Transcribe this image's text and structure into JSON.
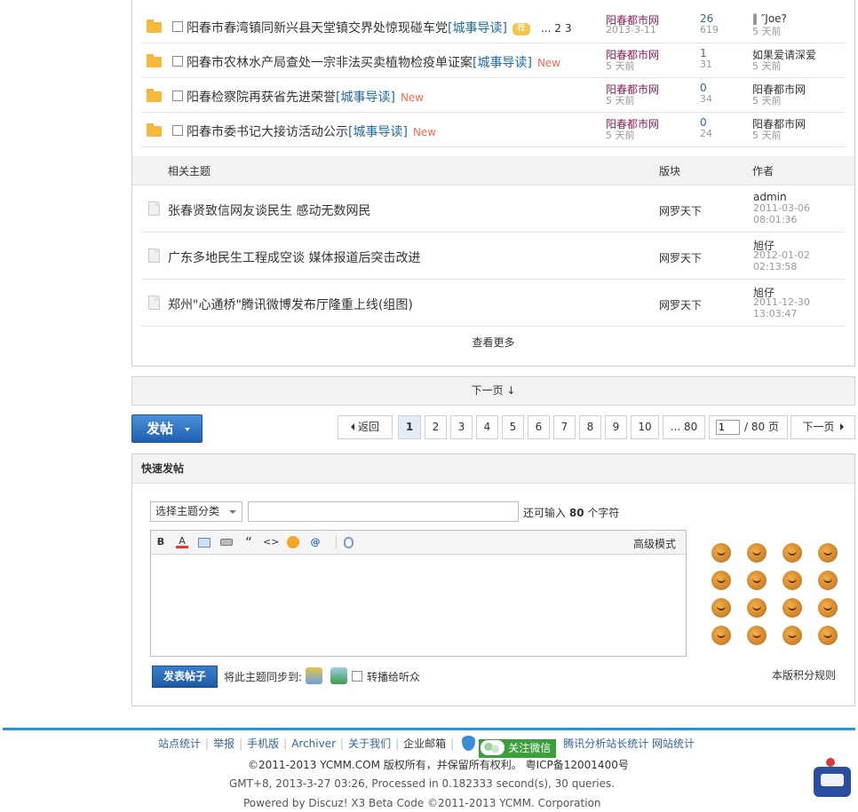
{
  "threads": [
    {
      "title": "阳春市春湾镇同新兴县天堂镇交界处惊现碰车党",
      "type": "[城事导读]",
      "badge": "荐",
      "pages": [
        "...",
        "2",
        "3"
      ],
      "new": "",
      "author": "阳春都市网",
      "date": "2013-3-11",
      "replies": "26",
      "views": "619",
      "lastpost": "‖ ″Joe?",
      "lastdate": "5 天前"
    },
    {
      "title": "阳春市农林水产局查处一宗非法买卖植物检疫单证案",
      "type": "[城事导读]",
      "badge": "",
      "pages": [],
      "new": "New",
      "author": "阳春都市网",
      "date": "5 天前",
      "replies": "1",
      "views": "31",
      "lastpost": "如果爱请深爱",
      "lastdate": "5 天前"
    },
    {
      "title": "阳春检察院再获省先进荣誉",
      "type": "[城事导读]",
      "badge": "",
      "pages": [],
      "new": "New",
      "author": "阳春都市网",
      "date": "5 天前",
      "replies": "0",
      "views": "34",
      "lastpost": "阳春都市网",
      "lastdate": "5 天前"
    },
    {
      "title": "阳春市委书记大接访活动公示",
      "type": "[城事导读]",
      "badge": "",
      "pages": [],
      "new": "New",
      "author": "阳春都市网",
      "date": "5 天前",
      "replies": "0",
      "views": "24",
      "lastpost": "阳春都市网",
      "lastdate": "5 天前"
    }
  ],
  "related": {
    "header": {
      "topic": "相关主题",
      "forum": "版块",
      "author": "作者"
    },
    "items": [
      {
        "title": "张春贤致信网友谈民生 感动无数网民",
        "forum": "网罗天下",
        "author": "admin",
        "date": "2011-03-06",
        "time": "08:01:36"
      },
      {
        "title": "广东多地民生工程成空谈 媒体报道后突击改进",
        "forum": "网罗天下",
        "author": "旭仔",
        "date": "2012-01-02",
        "time": "02:13:58"
      },
      {
        "title": "郑州\"心通桥\"腾讯微博发布厅隆重上线(组图)",
        "forum": "网罗天下",
        "author": "旭仔",
        "date": "2011-12-30",
        "time": "13:03:47"
      }
    ],
    "view_more": "查看更多"
  },
  "next_bar": "下一页 ↓",
  "post_button": "发帖",
  "pagination": {
    "back": "返回",
    "pages": [
      "1",
      "2",
      "3",
      "4",
      "5",
      "6",
      "7",
      "8",
      "9",
      "10",
      "... 80"
    ],
    "current": "1",
    "input_value": "1",
    "total": "/ 80 页",
    "next": "下一页"
  },
  "quick_post": {
    "title": "快速发帖",
    "type_select": "选择主题分类",
    "char_hint_prefix": "还可输入",
    "char_count": "80",
    "char_hint_suffix": "个字符",
    "toolbar": {
      "bold": "B",
      "color": "A",
      "quote": "“",
      "code": "<>",
      "at": "@"
    },
    "advanced": "高级模式",
    "submit": "发表帖子",
    "sync_label": "将此主题同步到:",
    "relay_label": "转播给听众",
    "rules": "本版积分规则"
  },
  "footer": {
    "links": [
      "站点统计",
      "举报",
      "手机版",
      "Archiver",
      "关于我们"
    ],
    "mail": "企业邮箱",
    "wechat": "关注微信",
    "stats": "腾讯分析站长统计 网站统计",
    "copyright": "©2011-2013 YCMM.COM 版权所有，并保留所有权利。 粤ICP备12001400号",
    "gmt": "GMT+8, 2013-3-27 03:26, Processed in 0.182333 second(s), 30 queries.",
    "powered": "Powered by Discuz! X3 Beta Code ©2011-2013 YCMM. Corporation"
  },
  "colors": {
    "accent": "#2e6dbe",
    "footer_line": "#2b93d1",
    "author": "#8a1f5a",
    "type_link": "#1e6aa8",
    "new": "#f26c4f"
  }
}
